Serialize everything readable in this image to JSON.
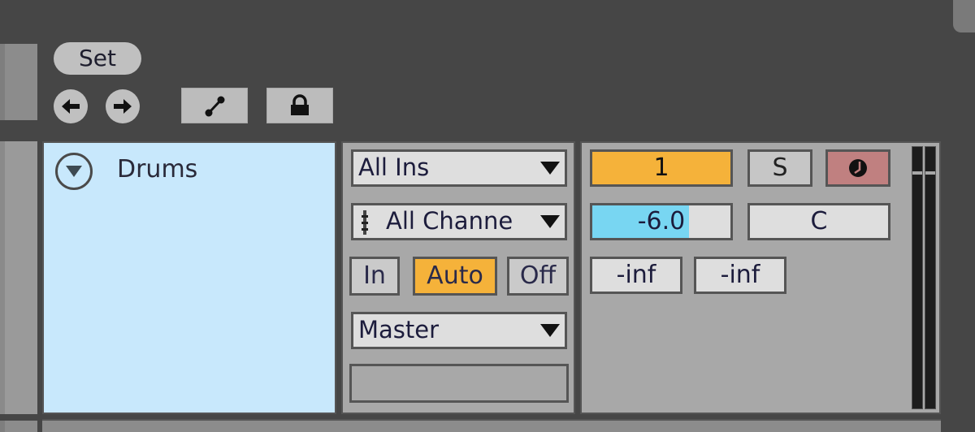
{
  "toolbar": {
    "set_label": "Set",
    "nav_back_icon": "arrow-left-icon",
    "nav_forward_icon": "arrow-right-icon",
    "automation_icon": "automation-node-icon",
    "lock_icon": "lock-icon"
  },
  "track": {
    "name": "Drums",
    "color": "#c8e8fc",
    "fold_icon": "fold-triangle-down-icon"
  },
  "io": {
    "input_type": "All Ins",
    "input_channel": "All Channels",
    "input_channel_display": "All Channe",
    "monitor": {
      "options": [
        "In",
        "Auto",
        "Off"
      ],
      "selected": "Auto"
    },
    "output": "Master",
    "output_sub": ""
  },
  "mixer": {
    "track_number": "1",
    "solo_label": "S",
    "arm_icon": "record-arm-icon",
    "volume": "-6.0",
    "volume_fill_fraction": 0.7,
    "pan": "C",
    "peak_left": "-inf",
    "peak_right": "-inf"
  },
  "colors": {
    "accent_orange": "#f5b23a",
    "volume_blue": "#78d6f2",
    "arm_red": "#c08080",
    "background": "#464646"
  }
}
